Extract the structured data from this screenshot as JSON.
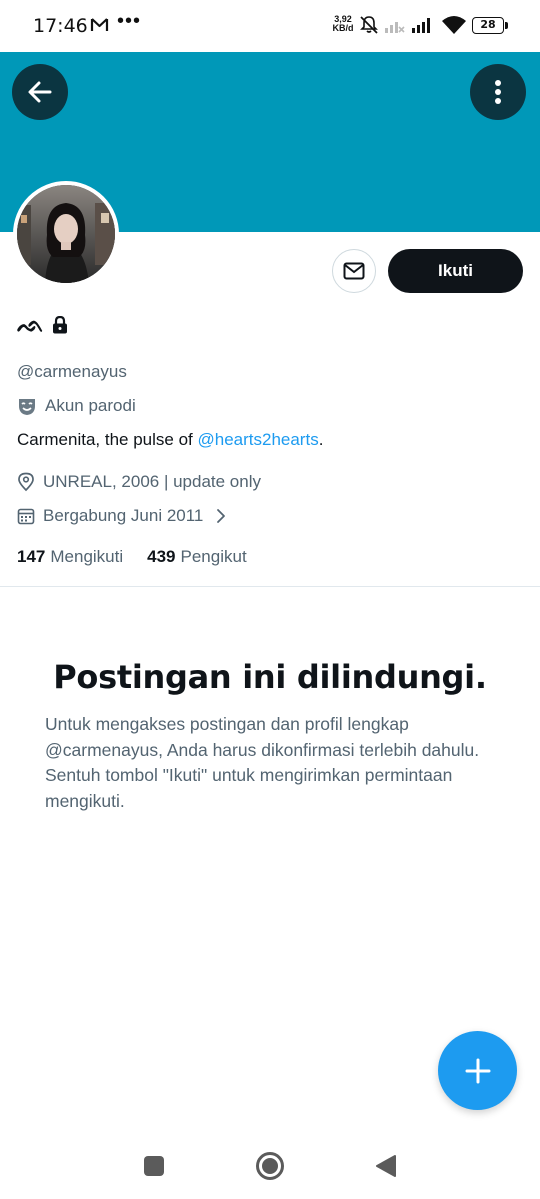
{
  "status_bar": {
    "time": "17:46",
    "network_speed_value": "3,92",
    "network_speed_unit": "KB/d",
    "battery": "28",
    "icons": [
      "gmail-icon",
      "more-dots-icon",
      "bell-muted-icon",
      "signal-icon",
      "signal-icon",
      "wifi-icon",
      "battery-icon"
    ]
  },
  "banner": {
    "color": "#0098b8"
  },
  "profile": {
    "display_name": "ᨒ",
    "handle": "@carmenayus",
    "parody_label": "Akun parodi",
    "bio_prefix": "Carmenita, the pulse of ",
    "bio_link": "@hearts2hearts",
    "bio_suffix": ".",
    "location": "UNREAL, 2006 | update only",
    "joined": "Bergabung Juni 2011",
    "following_count": "147",
    "following_label": "Mengikuti",
    "followers_count": "439",
    "followers_label": "Pengikut"
  },
  "actions": {
    "follow_label": "Ikuti"
  },
  "protected": {
    "title": "Postingan ini dilindungi.",
    "body": "Untuk mengakses postingan dan profil lengkap @carmenayus, Anda harus dikonfirmasi terlebih dahulu. Sentuh tombol \"Ikuti\" untuk mengirimkan permintaan mengikuti."
  },
  "colors": {
    "accent": "#1d9bf0",
    "banner": "#0098b8",
    "text_primary": "#0f1419",
    "text_secondary": "#536471"
  }
}
